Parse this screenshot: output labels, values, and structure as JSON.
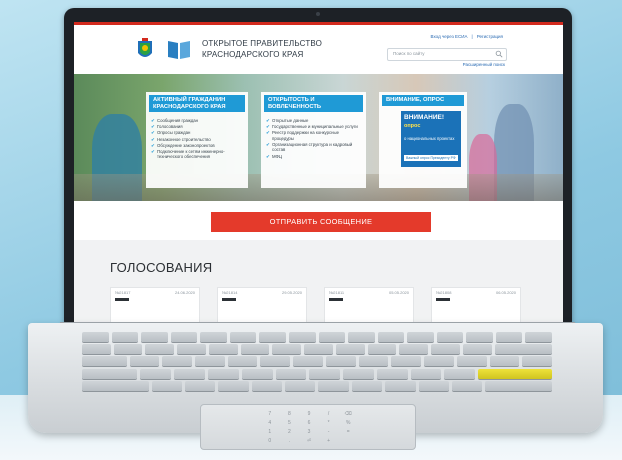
{
  "site": {
    "title_line1": "ОТКРЫТОЕ ПРАВИТЕЛЬСТВО",
    "title_line2": "КРАСНОДАРСКОГО КРАЯ",
    "login_link": "Вход через ЕСИА",
    "separator": "|",
    "register_link": "Регистрация",
    "search_placeholder": "Поиск по сайту",
    "advanced_search": "Расширенный поиск"
  },
  "hero": {
    "cards": [
      {
        "heading": "АКТИВНЫЙ ГРАЖДАНИН КРАСНОДАРСКОГО КРАЯ",
        "items": [
          "Сообщения граждан",
          "Голосования",
          "Опросы граждан",
          "Незаконное строительство",
          "Обсуждение законопроектов",
          "Подключение к сетям инженерно-технического обеспечения"
        ]
      },
      {
        "heading": "ОТКРЫТОСТЬ И ВОВЛЕЧЕННОСТЬ",
        "items": [
          "Открытые данные",
          "Государственные и муниципальные услуги",
          "Реестр поддержки на конкурсные процедуры",
          "Организационная структура и кадровый состав",
          "МФЦ"
        ]
      }
    ],
    "poll_card": {
      "heading": "ВНИМАНИЕ, ОПРОС",
      "banner_line1": "ВНИМАНИЕ!",
      "banner_line2": "опрос",
      "banner_line3": "о национальных проектах",
      "banner_footer": "Важный опрос Президенту РФ"
    }
  },
  "send_button": "ОТПРАВИТЬ СООБЩЕНИЕ",
  "votes": {
    "title": "ГОЛОСОВАНИЯ",
    "cards": [
      {
        "number": "№21817",
        "date": "24.06.2020"
      },
      {
        "number": "№21814",
        "date": "29.05.2020"
      },
      {
        "number": "№21811",
        "date": "05.05.2020"
      },
      {
        "number": "№21808",
        "date": "06.05.2020"
      }
    ]
  },
  "laptop": {
    "brand": "Изображение ноутбука",
    "numpad": [
      "7",
      "8",
      "9",
      "/",
      "⌫",
      "4",
      "5",
      "6",
      "*",
      "%",
      "1",
      "2",
      "3",
      "-",
      "=",
      "0",
      ".",
      "⏎",
      "+",
      ""
    ]
  }
}
